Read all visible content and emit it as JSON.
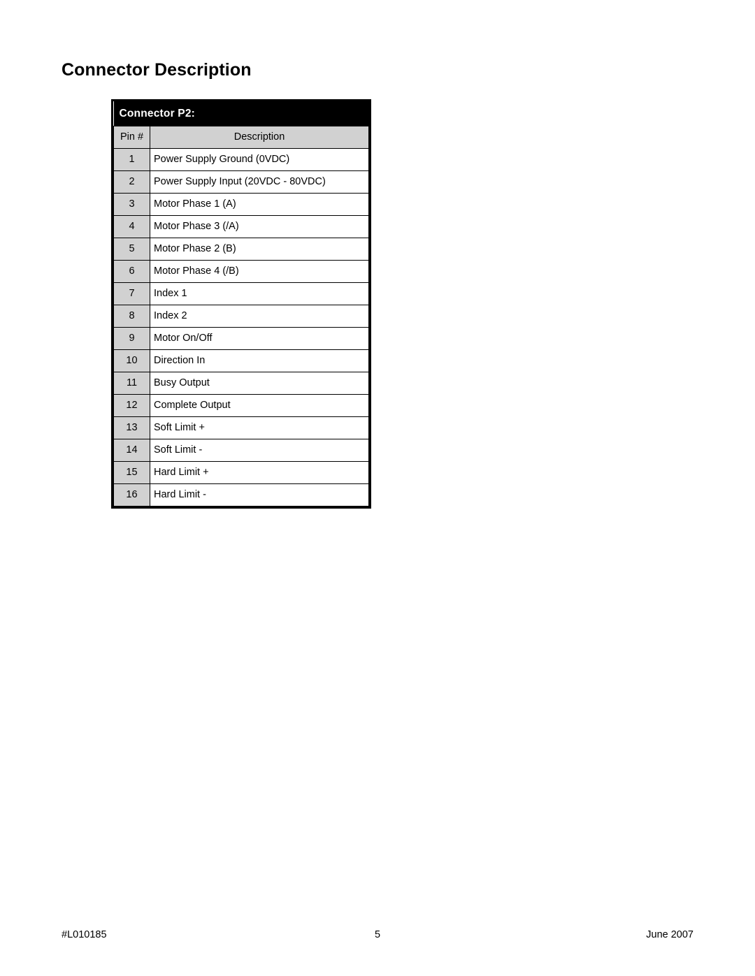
{
  "document": {
    "section_title": "Connector Description"
  },
  "table": {
    "banner_label": "Connector P2:",
    "columns": {
      "pin": "Pin #",
      "description": "Description"
    },
    "rows": [
      {
        "pin": "1",
        "description": "Power Supply Ground (0VDC)"
      },
      {
        "pin": "2",
        "description": "Power Supply Input (20VDC - 80VDC)"
      },
      {
        "pin": "3",
        "description": "Motor Phase 1 (A)"
      },
      {
        "pin": "4",
        "description": "Motor Phase 3 (/A)"
      },
      {
        "pin": "5",
        "description": "Motor Phase 2 (B)"
      },
      {
        "pin": "6",
        "description": "Motor Phase 4 (/B)"
      },
      {
        "pin": "7",
        "description": "Index 1"
      },
      {
        "pin": "8",
        "description": "Index 2"
      },
      {
        "pin": "9",
        "description": "Motor On/Off"
      },
      {
        "pin": "10",
        "description": "Direction In"
      },
      {
        "pin": "11",
        "description": "Busy Output"
      },
      {
        "pin": "12",
        "description": "Complete Output"
      },
      {
        "pin": "13",
        "description": "Soft Limit +"
      },
      {
        "pin": "14",
        "description": "Soft Limit -"
      },
      {
        "pin": "15",
        "description": "Hard Limit +"
      },
      {
        "pin": "16",
        "description": "Hard Limit -"
      }
    ]
  },
  "footer": {
    "part_number": "#L010185",
    "page_number": "5",
    "date": "June 2007"
  },
  "colors": {
    "banner_background": "#000000",
    "banner_text": "#ffffff",
    "header_cell_background": "#d1d1d1",
    "pin_cell_background": "#d1d1d1",
    "description_cell_background": "#ffffff",
    "border": "#000000",
    "page_background": "#ffffff",
    "text": "#000000"
  }
}
